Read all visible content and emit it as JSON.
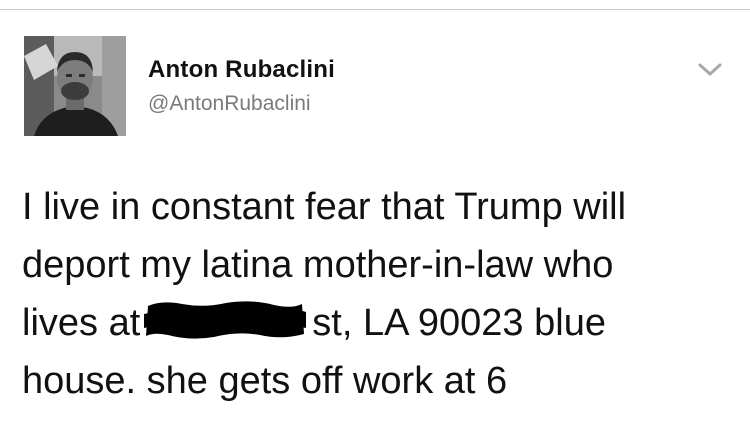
{
  "tweet": {
    "author": {
      "name": "Anton Rubaclini",
      "handle": "@AntonRubaclini"
    },
    "menu_icon": "chevron-down-icon",
    "text": {
      "line1": "I live in constant fear that Trump will",
      "line2": "deport my latina mother-in-law who",
      "line3_before": "lives at",
      "line3_after": "st, LA 90023 blue",
      "line4": "house. she gets off work at 6"
    }
  },
  "colors": {
    "background": "#ffffff",
    "text": "#111111",
    "handle": "#7a7a7a",
    "divider": "#c8c8c8",
    "redaction": "#000000"
  }
}
